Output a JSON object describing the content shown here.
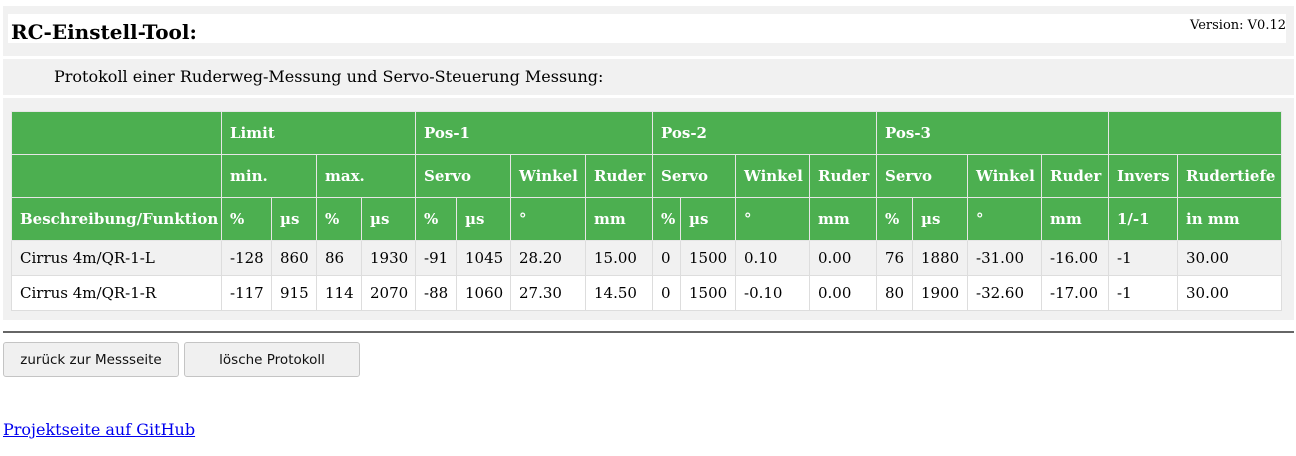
{
  "app": {
    "title": "RC-Einstell-Tool:",
    "version": "Version: V0.12",
    "subtitle": "Protokoll einer Ruderweg-Messung und Servo-Steuerung Messung:"
  },
  "table": {
    "header_row1": {
      "limit": "Limit",
      "pos1": "Pos-1",
      "pos2": "Pos-2",
      "pos3": "Pos-3"
    },
    "header_row2": {
      "min": "min.",
      "max": "max.",
      "p1_servo": "Servo",
      "p1_winkel": "Winkel",
      "p1_ruder": "Ruder",
      "p2_servo": "Servo",
      "p2_winkel": "Winkel",
      "p2_ruder": "Ruder",
      "p3_servo": "Servo",
      "p3_winkel": "Winkel",
      "p3_ruder": "Ruder",
      "invers": "Invers",
      "rudertiefe": "Rudertiefe"
    },
    "header_row3": [
      "Beschreibung/Funktion",
      "%",
      "µs",
      "%",
      "µs",
      "%",
      "µs",
      "°",
      "mm",
      "%",
      "µs",
      "°",
      "mm",
      "%",
      "µs",
      "°",
      "mm",
      "1/-1",
      "in mm"
    ],
    "rows": [
      [
        "Cirrus 4m/QR-1-L",
        "-128",
        "860",
        "86",
        "1930",
        "-91",
        "1045",
        "28.20",
        "15.00",
        "0",
        "1500",
        "0.10",
        "0.00",
        "76",
        "1880",
        "-31.00",
        "-16.00",
        "-1",
        "30.00"
      ],
      [
        "Cirrus 4m/QR-1-R",
        "-117",
        "915",
        "114",
        "2070",
        "-88",
        "1060",
        "27.30",
        "14.50",
        "0",
        "1500",
        "-0.10",
        "0.00",
        "80",
        "1900",
        "-32.60",
        "-17.00",
        "-1",
        "30.00"
      ]
    ]
  },
  "buttons": {
    "back": "zurück zur Messseite",
    "delete": "lösche Protokoll"
  },
  "links": {
    "github": "Projektseite auf GitHub"
  }
}
